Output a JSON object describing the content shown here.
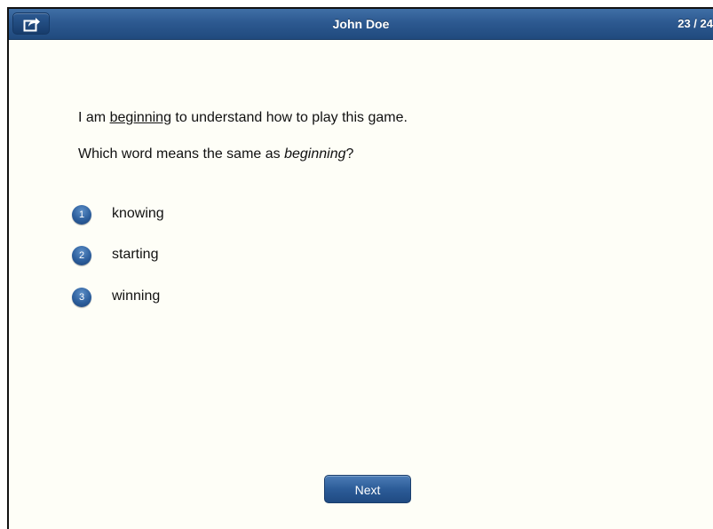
{
  "header": {
    "title": "John Doe",
    "progress": "23 / 24",
    "share_icon": "share-icon"
  },
  "prompt": {
    "sentence_before": "I am ",
    "sentence_word": "beginning",
    "sentence_after": " to understand how to play this game.",
    "question_before": "Which word means the same as ",
    "question_word": "beginning",
    "question_after": "?"
  },
  "options": [
    {
      "number": "1",
      "label": "knowing"
    },
    {
      "number": "2",
      "label": "starting"
    },
    {
      "number": "3",
      "label": "winning"
    }
  ],
  "footer": {
    "next_label": "Next"
  },
  "colors": {
    "header_blue": "#2d5990",
    "badge_blue": "#2d5f9d",
    "background": "#fefef7"
  }
}
